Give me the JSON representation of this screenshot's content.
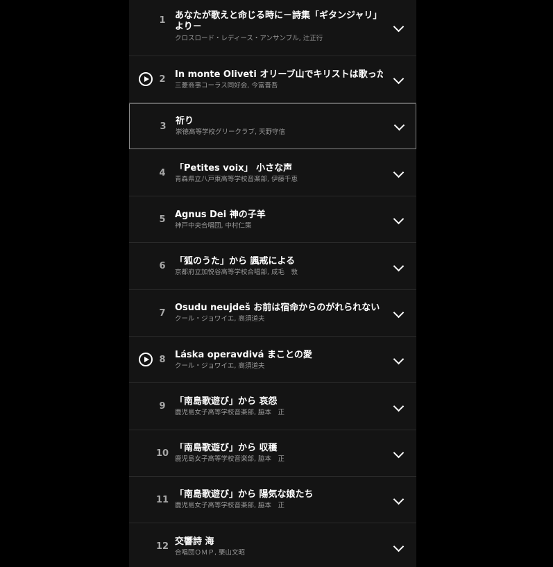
{
  "tracks": [
    {
      "number": "1",
      "title": "あなたが歌えと命じる時に－詩集「ギタンジャリ」より－",
      "artist": "クロスロード・レディース・アンサンブル, 辻正行",
      "has_play": false,
      "selected": false
    },
    {
      "number": "2",
      "title": "In monte Oliveti オリーブ山でキリストは歌った",
      "artist": "三菱商事コーラス同好会, 今富晋吾",
      "has_play": true,
      "selected": false
    },
    {
      "number": "3",
      "title": "祈り",
      "artist": "崇徳高等学校グリークラブ, 天野守信",
      "has_play": false,
      "selected": true
    },
    {
      "number": "4",
      "title": "「Petites voix」 小さな声",
      "artist": "青森県立八戸東高等学校音楽部, 伊藤千恵",
      "has_play": false,
      "selected": false
    },
    {
      "number": "5",
      "title": "Agnus Dei 神の子羊",
      "artist": "神戸中央合唱団, 中村仁策",
      "has_play": false,
      "selected": false
    },
    {
      "number": "6",
      "title": "「狐のうた」から 諷戒による",
      "artist": "京都府立加悦谷高等学校合唱部, 成毛　敦",
      "has_play": false,
      "selected": false
    },
    {
      "number": "7",
      "title": "Osudu neujdeš お前は宿命からのがれられない",
      "artist": "クール・ジョワイエ, 高須道夫",
      "has_play": false,
      "selected": false
    },
    {
      "number": "8",
      "title": "Láska operavdivá まことの愛",
      "artist": "クール・ジョワイエ, 高須道夫",
      "has_play": true,
      "selected": false
    },
    {
      "number": "9",
      "title": "「南島歌遊び」から 哀怨",
      "artist": "鹿児島女子高等学校音楽部, 脇本　正",
      "has_play": false,
      "selected": false
    },
    {
      "number": "10",
      "title": "「南島歌遊び」から 収穫",
      "artist": "鹿児島女子高等学校音楽部, 脇本　正",
      "has_play": false,
      "selected": false
    },
    {
      "number": "11",
      "title": "「南島歌遊び」から 陽気な娘たち",
      "artist": "鹿児島女子高等学校音楽部, 脇本　正",
      "has_play": false,
      "selected": false
    },
    {
      "number": "12",
      "title": "交響詩 海",
      "artist": "合唱団ＯＭＰ, 栗山文昭",
      "has_play": false,
      "selected": false
    }
  ],
  "icons": {
    "play": "play-circle-icon",
    "expand": "chevron-down-icon"
  },
  "colors": {
    "panel_background": "#141414",
    "page_background": "#000000",
    "title_text": "#ffffff",
    "secondary_text": "#9a9a9a",
    "selected_border": "#8a8a8a"
  }
}
